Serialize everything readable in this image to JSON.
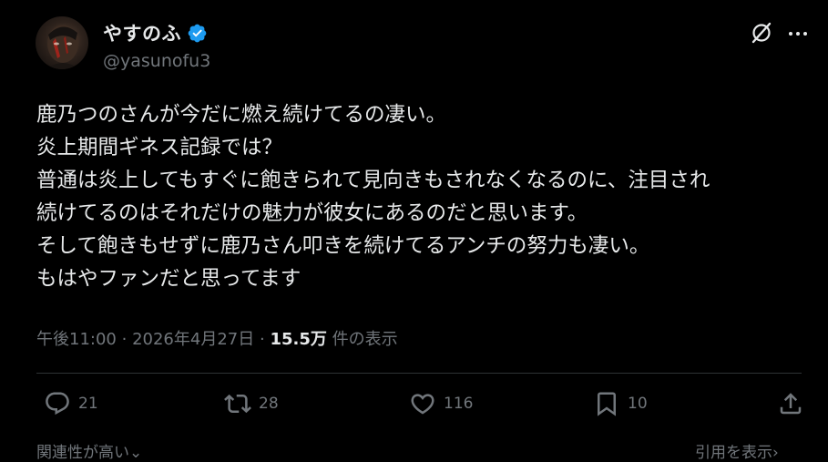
{
  "author": {
    "display_name": "やすのふ",
    "handle": "@yasunofu3",
    "verified": true
  },
  "body_lines": [
    "鹿乃つのさんが今だに燃え続けてるの凄い。",
    "炎上期間ギネス記録では？",
    "普通は炎上してもすぐに飽きられて見向きもされなくなるのに、注目され",
    "続けてるのはそれだけの魅力が彼女にあるのだと思います。",
    "そして飽きもせずに鹿乃さん叩きを続けてるアンチの努力も凄い。",
    "もはやファンだと思ってます"
  ],
  "meta": {
    "time": "午後11:00",
    "separator": "·",
    "date": "2026年4月27日",
    "views_count": "15.5万",
    "views_label": "件の表示"
  },
  "actions": {
    "reply_count": "21",
    "retweet_count": "28",
    "like_count": "116",
    "bookmark_count": "10"
  },
  "footer": {
    "sort_label": "関連性が高い",
    "quotes_label": "引用を表示"
  },
  "colors": {
    "background": "#000000",
    "text_primary": "#e7e9ea",
    "text_secondary": "#71767b",
    "verified_badge": "#1d9bf0",
    "divider": "#2f3336"
  },
  "icons": {
    "verified": "verified-badge-icon",
    "grok": "grok-icon",
    "more": "more-horizontal-icon",
    "reply": "reply-icon",
    "retweet": "retweet-icon",
    "like": "heart-icon",
    "bookmark": "bookmark-icon",
    "share": "share-icon"
  }
}
